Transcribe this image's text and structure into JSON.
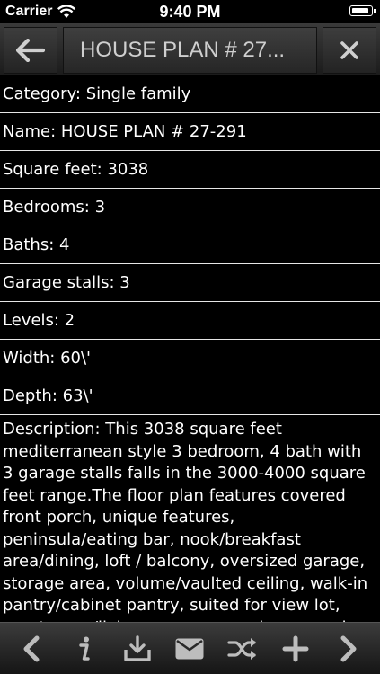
{
  "status_bar": {
    "carrier": "Carrier",
    "time": "9:40 PM",
    "battery_level": 0.95,
    "icons": [
      "wifi-icon",
      "battery-icon"
    ]
  },
  "nav": {
    "title": "HOUSE PLAN # 27...",
    "back_icon": "arrow-left-icon",
    "close_icon": "close-icon"
  },
  "details": {
    "category": "Category: Single family",
    "name": "Name: HOUSE PLAN # 27-291",
    "square_feet": "Square feet: 3038",
    "bedrooms": "Bedrooms: 3",
    "baths": "Baths: 4",
    "garage_stalls": "Garage stalls: 3",
    "levels": "Levels: 2",
    "width": "Width: 60\\'",
    "depth": "Depth: 63\\'",
    "description": "Description: This 3038 square feet mediterranean style 3 bedroom, 4 bath with 3 garage stalls falls in the 3000-4000 square feet range.The floor plan features covered front porch, unique features, peninsula/eating bar, nook/breakfast area/dining, loft / balcony, oversized garage, storage area, volume/vaulted ceiling, walk-in pantry/cabinet pantry, suited for view lot, great room/living room, covered rear porch, open floor plan, walk-in closet, tandem garage, grill deck/sundeck"
  },
  "toolbar": {
    "icons": [
      "chevron-left-icon",
      "info-icon",
      "download-icon",
      "mail-icon",
      "shuffle-icon",
      "plus-icon",
      "chevron-right-icon"
    ]
  },
  "colors": {
    "background": "#000000",
    "text": "#ffffff",
    "nav_title": "#cfcfcf",
    "divider": "#e6e6e6",
    "toolbar_icon": "#bdbdbd"
  }
}
